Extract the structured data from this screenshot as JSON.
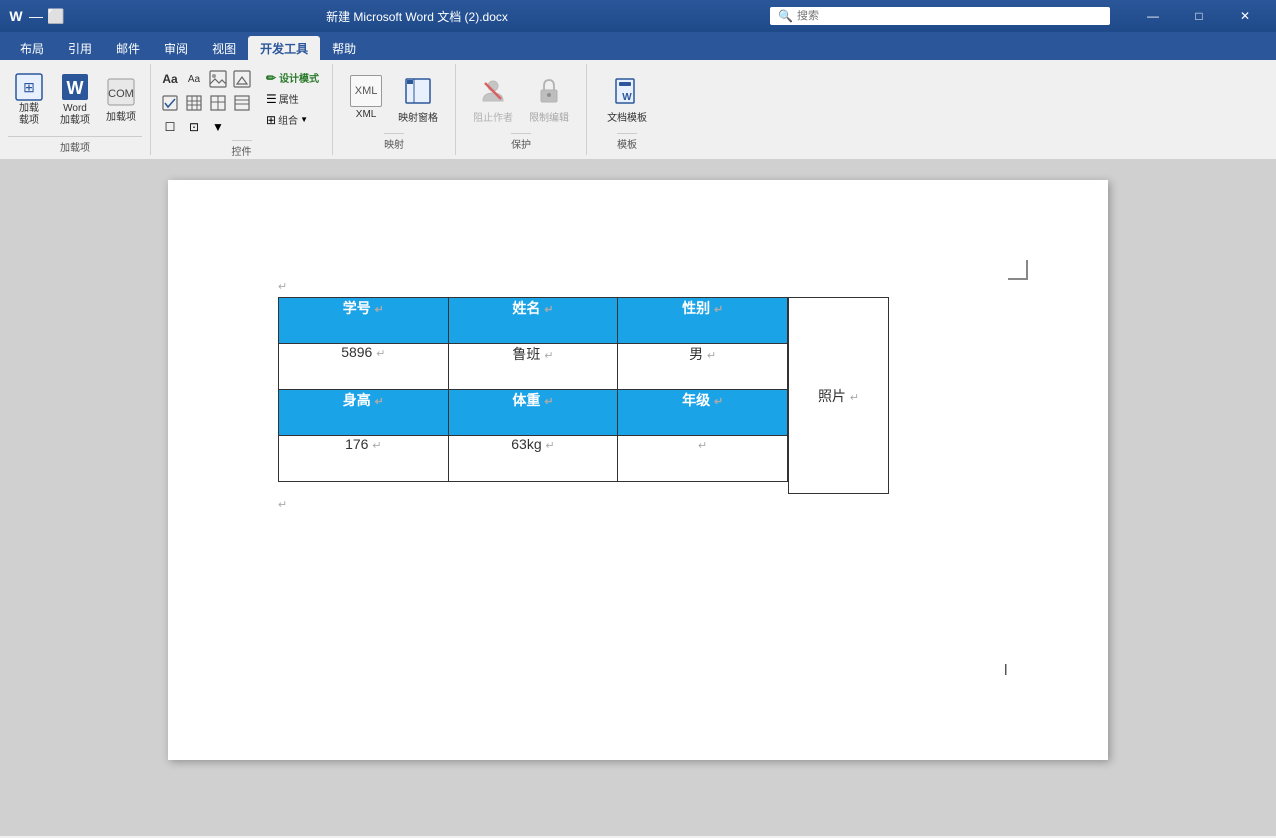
{
  "titlebar": {
    "title": "新建 Microsoft Word 文档 (2).docx",
    "search_placeholder": "搜索",
    "minimize_label": "最小化",
    "maximize_label": "最大化",
    "close_label": "关闭"
  },
  "tabs": [
    {
      "id": "buJu",
      "label": "布局"
    },
    {
      "id": "yiYong",
      "label": "引用"
    },
    {
      "id": "youJian",
      "label": "邮件"
    },
    {
      "id": "shenYue",
      "label": "审阅"
    },
    {
      "id": "shiTu",
      "label": "视图"
    },
    {
      "id": "kaiFaGongJu",
      "label": "开发工具",
      "active": true
    },
    {
      "id": "bangZhu",
      "label": "帮助"
    }
  ],
  "ribbon": {
    "groups": [
      {
        "id": "addins",
        "label": "加载项",
        "items": [
          {
            "id": "add-addin",
            "label": "加载\n载项",
            "icon": "⊞"
          },
          {
            "id": "word-addin",
            "label": "Word\n加载项",
            "icon": "W"
          },
          {
            "id": "com-addin",
            "label": "COM",
            "icon": "C"
          },
          {
            "id": "manage-addin",
            "label": "加载项",
            "icon": "≡"
          }
        ]
      },
      {
        "id": "controls",
        "label": "控件",
        "items": [
          {
            "id": "design-mode",
            "label": "设计模式",
            "icon": "✏"
          },
          {
            "id": "properties",
            "label": "属性",
            "icon": "≡"
          },
          {
            "id": "group",
            "label": "组合",
            "icon": "⊞"
          }
        ]
      },
      {
        "id": "mapping",
        "label": "映射",
        "items": [
          {
            "id": "xml",
            "label": "XML",
            "icon": "</>"
          },
          {
            "id": "map-window",
            "label": "映射窗格",
            "icon": "⊞"
          }
        ]
      },
      {
        "id": "protect",
        "label": "保护",
        "items": [
          {
            "id": "block-authors",
            "label": "阻止作者",
            "icon": "🚫"
          },
          {
            "id": "restrict-edit",
            "label": "限制编辑",
            "icon": "🔒"
          }
        ]
      },
      {
        "id": "templates",
        "label": "模板",
        "items": [
          {
            "id": "doc-template",
            "label": "文档模板",
            "icon": "W"
          }
        ]
      }
    ]
  },
  "document": {
    "table": {
      "headers": [
        "学号",
        "姓名",
        "性别"
      ],
      "data_row1": [
        "5896",
        "鲁班",
        "男"
      ],
      "headers2": [
        "身高",
        "体重",
        "年级"
      ],
      "data_row2": [
        "176",
        "63kg",
        ""
      ],
      "photo_label": "照片"
    }
  }
}
